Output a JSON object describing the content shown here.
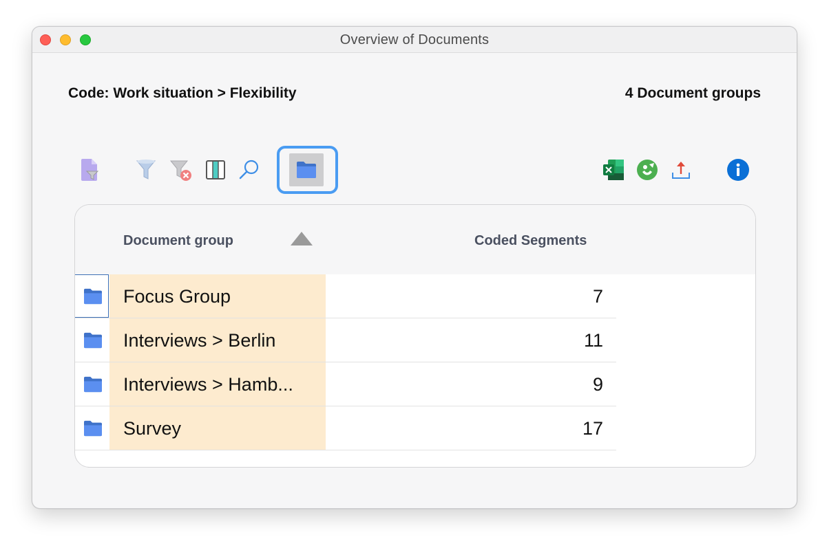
{
  "window": {
    "title": "Overview of Documents"
  },
  "header": {
    "code_label": "Code: Work situation > Flexibility",
    "group_count": "4 Document groups"
  },
  "toolbar": {
    "left_icons": [
      "document-filter-icon",
      "funnel-icon",
      "funnel-clear-icon",
      "columns-icon",
      "search-icon",
      "folder-icon"
    ],
    "right_icons": [
      "excel-export-icon",
      "smartpublisher-icon",
      "export-icon",
      "info-icon"
    ],
    "active": "folder-icon"
  },
  "table": {
    "columns": [
      "Document group",
      "Coded Segments"
    ],
    "sort": {
      "column": "Document group",
      "direction": "ascending"
    },
    "rows": [
      {
        "name": "Focus Group",
        "count": "7"
      },
      {
        "name": "Interviews > Berlin",
        "count": "11"
      },
      {
        "name": "Interviews > Hamb...",
        "count": "9"
      },
      {
        "name": "Survey",
        "count": "17"
      }
    ]
  },
  "colors": {
    "accent": "#4a9cf2",
    "name_highlight": "#fdebcf",
    "folder_icon": "#4f86e8"
  }
}
